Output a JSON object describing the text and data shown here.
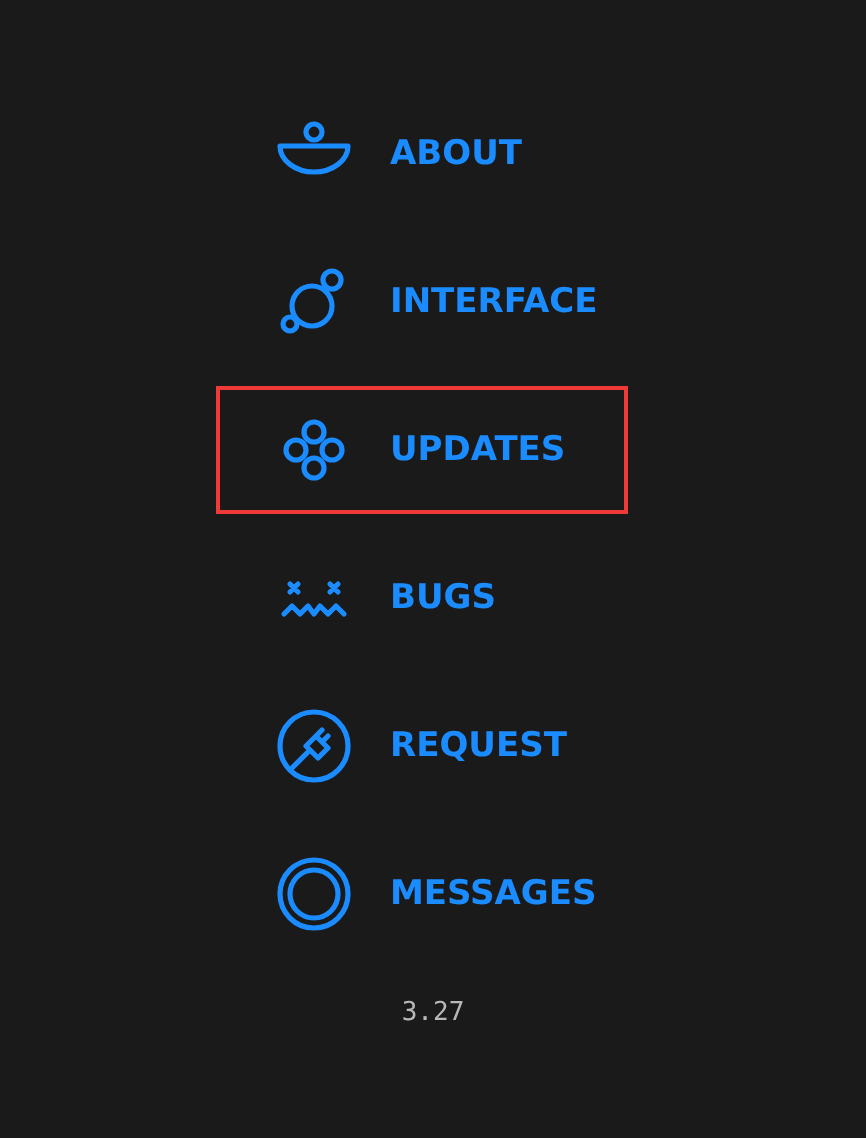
{
  "menu": {
    "items": [
      {
        "label": "ABOUT",
        "kind": "bowl",
        "selected": false
      },
      {
        "label": "INTERFACE",
        "kind": "orbit",
        "selected": false
      },
      {
        "label": "UPDATES",
        "kind": "clover",
        "selected": true
      },
      {
        "label": "BUGS",
        "kind": "face",
        "selected": false
      },
      {
        "label": "REQUEST",
        "kind": "plug",
        "selected": false
      },
      {
        "label": "MESSAGES",
        "kind": "ring",
        "selected": false
      }
    ]
  },
  "version": "3.27"
}
